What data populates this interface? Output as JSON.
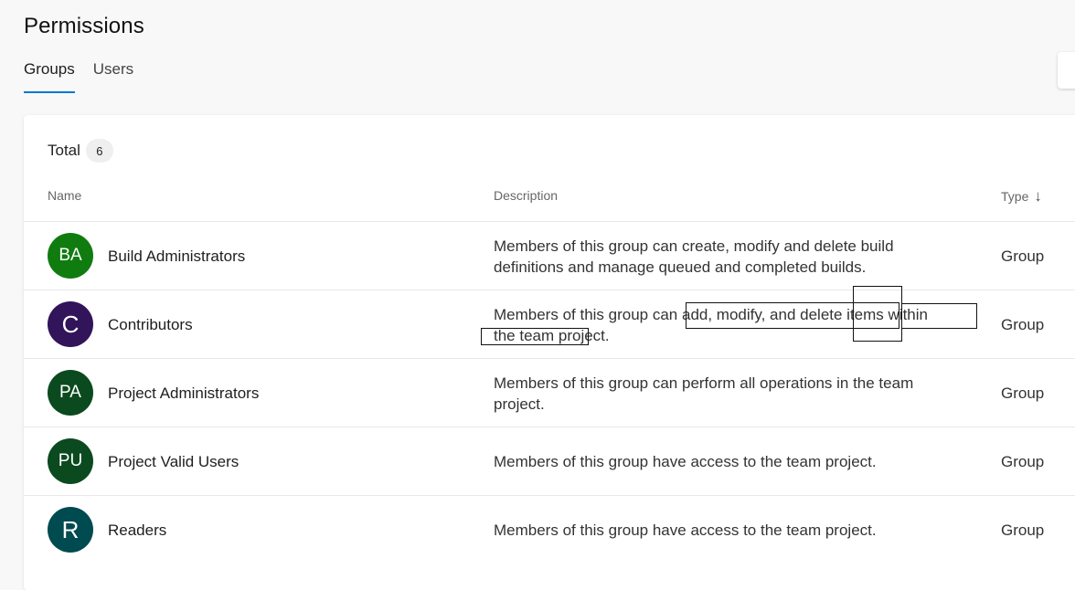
{
  "page": {
    "title": "Permissions"
  },
  "tabs": [
    {
      "label": "Groups",
      "active": true
    },
    {
      "label": "Users",
      "active": false
    }
  ],
  "summary": {
    "total_label": "Total",
    "total_count": "6"
  },
  "table": {
    "columns": {
      "name": "Name",
      "description": "Description",
      "type": "Type"
    },
    "sort_icon": "arrow-down",
    "rows": [
      {
        "initials": "BA",
        "avatar_color": "#107c10",
        "name": "Build Administrators",
        "description": "Members of this group can create, modify and delete build definitions and manage queued and completed builds.",
        "type": "Group"
      },
      {
        "initials": "C",
        "avatar_color": "#32145a",
        "name": "Contributors",
        "description": "Members of this group can add, modify, and delete items within the team project.",
        "type": "Group"
      },
      {
        "initials": "PA",
        "avatar_color": "#0b4a1f",
        "name": "Project Administrators",
        "description": "Members of this group can perform all operations in the team project.",
        "type": "Group"
      },
      {
        "initials": "PU",
        "avatar_color": "#0b4a1f",
        "name": "Project Valid Users",
        "description": "Members of this group have access to the team project.",
        "type": "Group"
      },
      {
        "initials": "R",
        "avatar_color": "#004b50",
        "name": "Readers",
        "description": "Members of this group have access to the team project.",
        "type": "Group"
      }
    ]
  }
}
